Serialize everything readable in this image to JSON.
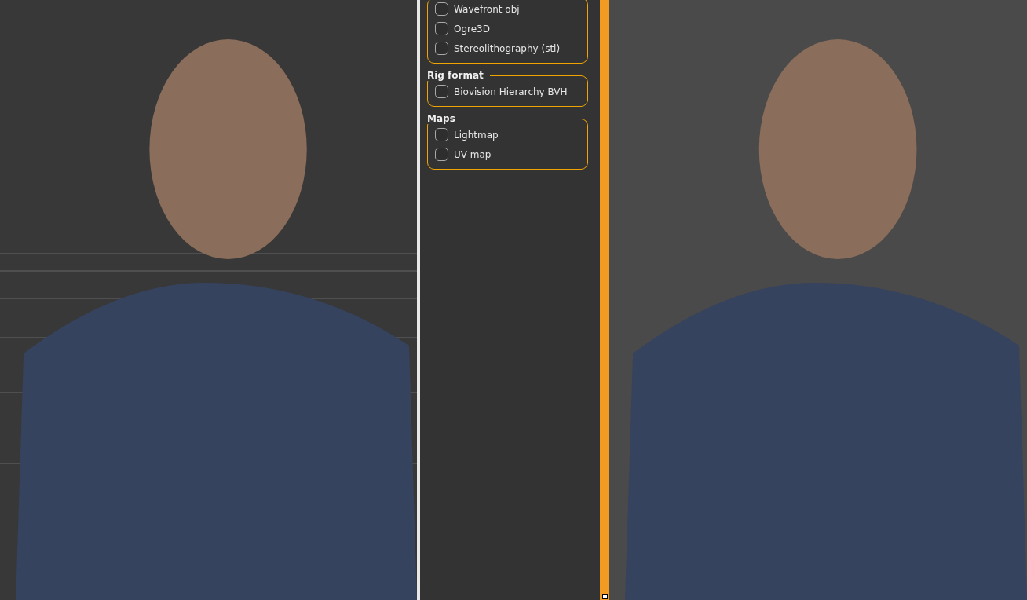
{
  "export_panel": {
    "groups": [
      {
        "options": [
          {
            "label": "Wavefront obj",
            "checked": false
          },
          {
            "label": "Ogre3D",
            "checked": false
          },
          {
            "label": "Stereolithography (stl)",
            "checked": false
          }
        ]
      },
      {
        "title": "Rig format",
        "options": [
          {
            "label": "Biovision Hierarchy BVH",
            "checked": false
          }
        ]
      },
      {
        "title": "Maps",
        "options": [
          {
            "label": "Lightmap",
            "checked": false
          },
          {
            "label": "UV map",
            "checked": false
          }
        ]
      }
    ]
  }
}
